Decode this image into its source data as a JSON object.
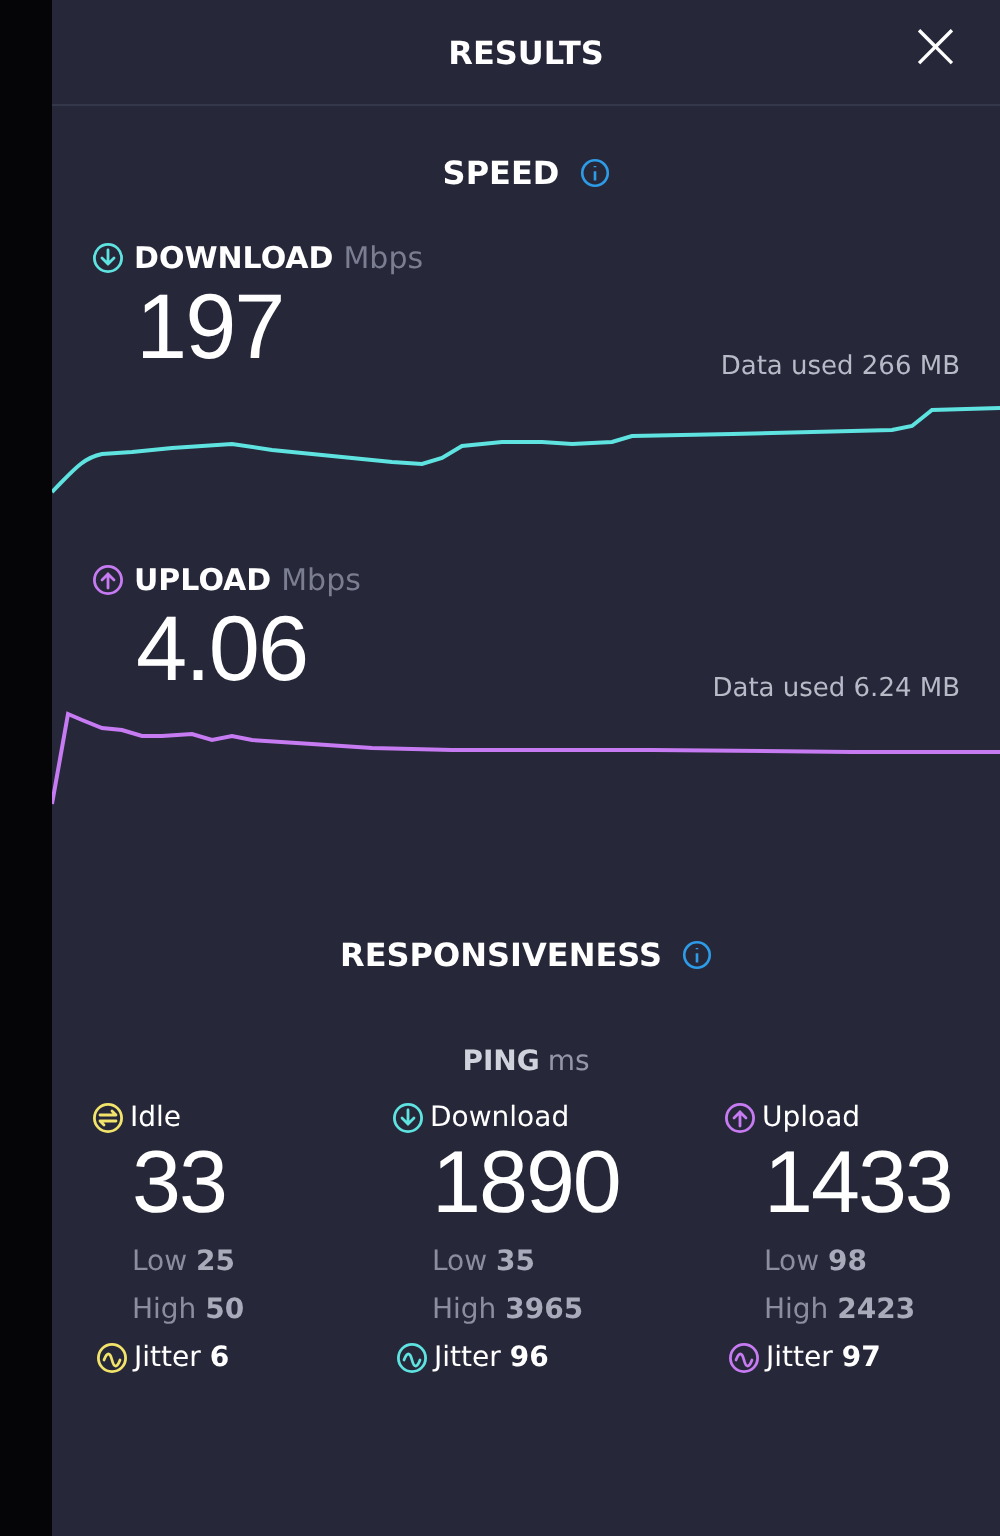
{
  "header": {
    "title": "RESULTS",
    "close": "×"
  },
  "speed": {
    "title": "SPEED",
    "tests": [
      {
        "kind": "download",
        "label": "DOWNLOAD",
        "unit": "Mbps",
        "value": "197",
        "data_used": "Data used 266 MB",
        "color": "#5ee3e0"
      },
      {
        "kind": "upload",
        "label": "UPLOAD",
        "unit": "Mbps",
        "value": "4.06",
        "data_used": "Data used 6.24 MB",
        "color": "#c77bf2"
      }
    ]
  },
  "responsiveness": {
    "title": "RESPONSIVENESS",
    "ping_label": "PING",
    "ping_unit": "ms",
    "columns": [
      {
        "kind": "idle",
        "label": "Idle",
        "value": "33",
        "low_label": "Low",
        "low": "25",
        "high_label": "High",
        "high": "50",
        "jitter_label": "Jitter",
        "jitter": "6",
        "color": "#f2e36b"
      },
      {
        "kind": "download",
        "label": "Download",
        "value": "1890",
        "low_label": "Low",
        "low": "35",
        "high_label": "High",
        "high": "3965",
        "jitter_label": "Jitter",
        "jitter": "96",
        "color": "#5ee3e0"
      },
      {
        "kind": "upload",
        "label": "Upload",
        "value": "1433",
        "low_label": "Low",
        "low": "98",
        "high_label": "High",
        "high": "2423",
        "jitter_label": "Jitter",
        "jitter": "97",
        "color": "#c77bf2"
      }
    ]
  }
}
